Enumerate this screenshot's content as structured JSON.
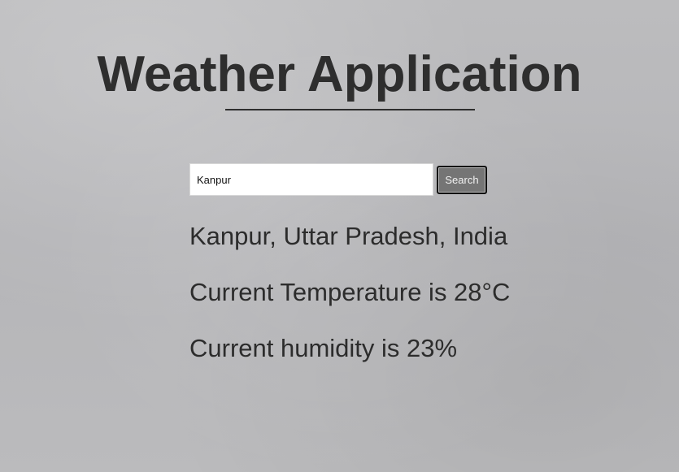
{
  "header": {
    "title": "Weather Application"
  },
  "search": {
    "value": "Kanpur",
    "button_label": "Search"
  },
  "results": {
    "location": "Kanpur, Uttar Pradesh, India",
    "temperature_text": "Current Temperature is 28°C",
    "humidity_text": "Current humidity is 23%"
  },
  "colors": {
    "background": "#b9b9bb",
    "text": "#2b2b2b",
    "button_bg": "#757575",
    "button_text": "#f2f2f2"
  }
}
